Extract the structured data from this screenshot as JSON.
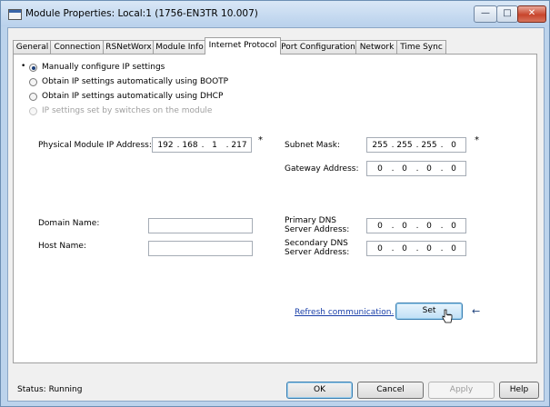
{
  "window": {
    "title": "Module Properties: Local:1 (1756-EN3TR 10.007)"
  },
  "window_controls": {
    "minimize": "—",
    "maximize": "□",
    "close": "✕"
  },
  "tabs": [
    {
      "label": "General"
    },
    {
      "label": "Connection"
    },
    {
      "label": "RSNetWorx"
    },
    {
      "label": "Module Info"
    },
    {
      "label": "Internet Protocol",
      "active": true
    },
    {
      "label": "Port Configuration"
    },
    {
      "label": "Network"
    },
    {
      "label": "Time Sync"
    }
  ],
  "ip_options": {
    "focus_marker": "•",
    "items": [
      {
        "label": "Manually configure IP settings",
        "selected": true,
        "enabled": true
      },
      {
        "label": "Obtain IP settings automatically using BOOTP",
        "selected": false,
        "enabled": true
      },
      {
        "label": "Obtain IP settings automatically using DHCP",
        "selected": false,
        "enabled": true
      },
      {
        "label": "IP settings set by switches on the module",
        "selected": false,
        "enabled": false
      }
    ]
  },
  "fields": {
    "physical_ip": {
      "label": "Physical Module IP Address:",
      "octets": [
        "192",
        "168",
        "1",
        "217"
      ],
      "marker": "*"
    },
    "subnet_mask": {
      "label": "Subnet Mask:",
      "octets": [
        "255",
        "255",
        "255",
        "0"
      ],
      "marker": "*"
    },
    "gateway": {
      "label": "Gateway Address:",
      "octets": [
        "0",
        "0",
        "0",
        "0"
      ]
    },
    "domain_name": {
      "label": "Domain Name:",
      "value": ""
    },
    "host_name": {
      "label": "Host Name:",
      "value": ""
    },
    "primary_dns": {
      "label": "Primary DNS Server Address:",
      "octets": [
        "0",
        "0",
        "0",
        "0"
      ]
    },
    "secondary_dns": {
      "label": "Secondary DNS Server Address:",
      "octets": [
        "0",
        "0",
        "0",
        "0"
      ]
    }
  },
  "actions": {
    "refresh_link": "Refresh communication.",
    "set_button": "Set",
    "pointer_arrow": "←"
  },
  "footer": {
    "status_label": "Status:",
    "status_value": "Running",
    "buttons": {
      "ok": "OK",
      "cancel": "Cancel",
      "apply": "Apply",
      "help": "Help"
    }
  },
  "colors": {
    "link": "#1a3fa8",
    "selection_dot": "#1b3f7a",
    "title_bar": "#c6dbf2",
    "close_button": "#c8452c"
  }
}
